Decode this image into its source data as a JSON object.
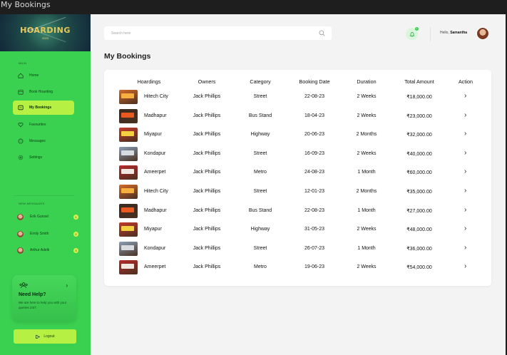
{
  "window": {
    "title": "My Bookings"
  },
  "brand": {
    "name": "HOARDING",
    "year": "2023"
  },
  "sidebar": {
    "main_label": "MAIN",
    "items": [
      {
        "label": "Home",
        "icon": "home-icon",
        "active": false
      },
      {
        "label": "Book Hoarding",
        "icon": "calendar-icon",
        "active": false
      },
      {
        "label": "My Bookings",
        "icon": "bookings-icon",
        "active": true
      },
      {
        "label": "Favourites",
        "icon": "heart-icon",
        "active": false
      },
      {
        "label": "Messages",
        "icon": "message-icon",
        "active": false
      },
      {
        "label": "Settings",
        "icon": "gear-icon",
        "active": false
      }
    ],
    "new_messages_label": "NEW MESSAGES",
    "messages": [
      {
        "name": "Erik Gunsel",
        "count": "1"
      },
      {
        "name": "Emily Smith",
        "count": "2"
      },
      {
        "name": "Arthur Adelk",
        "count": "3"
      }
    ],
    "help": {
      "title": "Need Help?",
      "subtitle": "We are here to help you with your queries 24/7."
    },
    "logout_label": "Logout"
  },
  "header": {
    "search_placeholder": "Search here",
    "notification_count": "1",
    "greeting_prefix": "Hello,",
    "user_name": "Samantha"
  },
  "page": {
    "title": "My Bookings"
  },
  "table": {
    "columns": [
      "Hoardings",
      "Owners",
      "Category",
      "Booking Date",
      "Duration",
      "Total Amount",
      "Action"
    ],
    "rows": [
      {
        "hoarding": "Hitech City",
        "owner": "Jack Phillips",
        "category": "Street",
        "date": "22-08-23",
        "duration": "2 Weeks",
        "amount": "₹18,000.00"
      },
      {
        "hoarding": "Madhapur",
        "owner": "Jack Phillips",
        "category": "Bus Stand",
        "date": "18-04-23",
        "duration": "2 Weeks",
        "amount": "₹23,000.00"
      },
      {
        "hoarding": "Miyapur",
        "owner": "Jack Phillips",
        "category": "Highway",
        "date": "20-06-23",
        "duration": "2 Months",
        "amount": "₹32,000.00"
      },
      {
        "hoarding": "Kondapur",
        "owner": "Jack Phillips",
        "category": "Street",
        "date": "16-09-23",
        "duration": "2 Weeks",
        "amount": "₹40,000.00"
      },
      {
        "hoarding": "Ameerpet",
        "owner": "Jack Phillips",
        "category": "Metro",
        "date": "24-08-23",
        "duration": "1 Month",
        "amount": "₹60,000.00"
      },
      {
        "hoarding": "Hitech City",
        "owner": "Jack Phillips",
        "category": "Street",
        "date": "12-01-23",
        "duration": "2 Months",
        "amount": "₹35,000.00"
      },
      {
        "hoarding": "Madhapur",
        "owner": "Jack Phillips",
        "category": "Bus Stand",
        "date": "22-08-23",
        "duration": "1 Month",
        "amount": "₹27,000.00"
      },
      {
        "hoarding": "Miyapur",
        "owner": "Jack Phillips",
        "category": "Highway",
        "date": "31-05-23",
        "duration": "2 Weeks",
        "amount": "₹48,000.00"
      },
      {
        "hoarding": "Kondapur",
        "owner": "Jack Phillips",
        "category": "Street",
        "date": "26-07-23",
        "duration": "1 Month",
        "amount": "₹36,000.00"
      },
      {
        "hoarding": "Ameerpet",
        "owner": "Jack Phillips",
        "category": "Metro",
        "date": "19-06-23",
        "duration": "2 Weeks",
        "amount": "₹54,000.00"
      }
    ]
  },
  "colors": {
    "sidebar": "#3bd150",
    "accent": "#b6f042",
    "brand_gold": "#e8c85a"
  }
}
